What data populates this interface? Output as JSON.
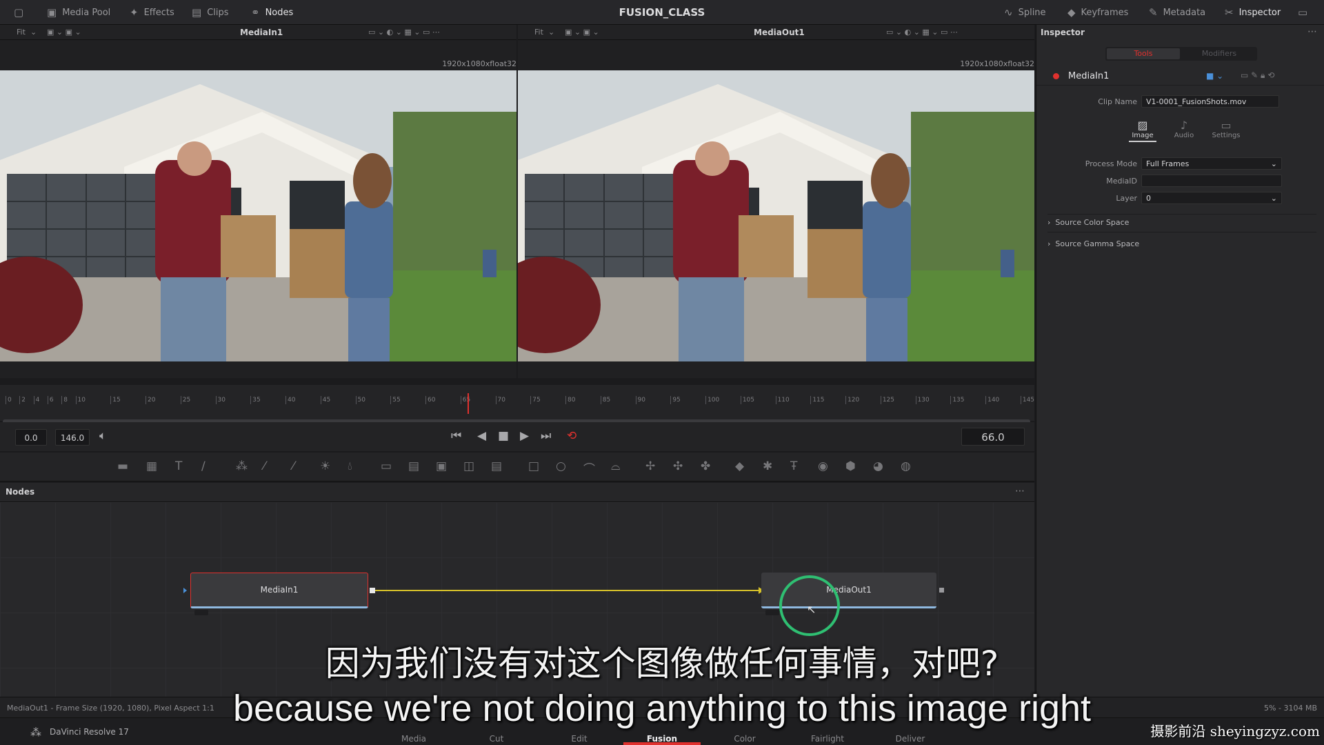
{
  "app": {
    "title": "FUSION_CLASS"
  },
  "topbar": {
    "media_pool": "Media Pool",
    "effects": "Effects",
    "clips": "Clips",
    "nodes": "Nodes",
    "spline": "Spline",
    "keyframes": "Keyframes",
    "metadata": "Metadata",
    "inspector": "Inspector"
  },
  "viewer_left": {
    "fit": "Fit",
    "title": "MediaIn1",
    "res": "1920x1080xfloat32"
  },
  "viewer_right": {
    "fit": "Fit",
    "title": "MediaOut1",
    "res": "1920x1080xfloat32"
  },
  "timeline": {
    "ticks": [
      "0",
      "2",
      "4",
      "6",
      "8",
      "10",
      "15",
      "20",
      "25",
      "30",
      "35",
      "40",
      "45",
      "50",
      "55",
      "60",
      "65",
      "70",
      "75",
      "80",
      "85",
      "90",
      "95",
      "100",
      "105",
      "110",
      "115",
      "120",
      "125",
      "130",
      "135",
      "140",
      "145"
    ],
    "playhead": 66,
    "range_max": 146
  },
  "transport": {
    "start": "0.0",
    "end": "146.0",
    "current": "66.0"
  },
  "nodes_panel": {
    "title": "Nodes",
    "node_in": "MediaIn1",
    "node_out": "MediaOut1"
  },
  "inspector": {
    "title": "Inspector",
    "tabs": {
      "tools": "Tools",
      "modifiers": "Modifiers"
    },
    "node_name": "MediaIn1",
    "clip_name_label": "Clip Name",
    "clip_name": "V1-0001_FusionShots.mov",
    "subtabs": {
      "image": "Image",
      "audio": "Audio",
      "settings": "Settings"
    },
    "process_mode_label": "Process Mode",
    "process_mode": "Full Frames",
    "mediaid_label": "MediaID",
    "mediaid": "",
    "layer_label": "Layer",
    "layer": "0",
    "source_color_space": "Source Color Space",
    "source_gamma_space": "Source Gamma Space"
  },
  "status": {
    "left": "MediaOut1 - Frame Size (1920, 1080), Pixel Aspect 1:1",
    "right": "5% - 3104 MB"
  },
  "bottom": {
    "brand": "DaVinci Resolve 17",
    "pages": [
      "Media",
      "Cut",
      "Edit",
      "Fusion",
      "Color",
      "Fairlight",
      "Deliver"
    ],
    "active_page": "Fusion"
  },
  "subtitles": {
    "zh": "因为我们没有对这个图像做任何事情，对吧?",
    "en": "because we're not doing anything to this image right"
  },
  "watermark": "摄影前沿 sheyingzyz.com",
  "colors": {
    "accent": "#e0312e",
    "link": "#d6c12a",
    "highlight": "#2fbf72"
  }
}
